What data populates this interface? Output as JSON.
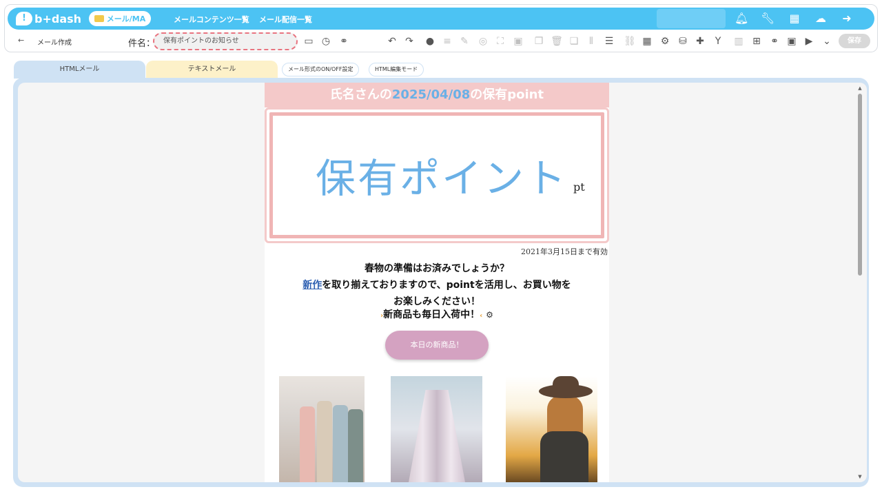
{
  "header": {
    "logo_text": "b+dash",
    "logo_bubble": "!",
    "mail_pill": "メール/MA",
    "nav": [
      "メールコンテンツ一覧",
      "メール配信一覧"
    ],
    "icons": [
      "bell-icon",
      "wrench-icon",
      "grid-icon",
      "support-icon",
      "logout-icon"
    ]
  },
  "subbar": {
    "back_arrow": "←",
    "page_title": "メール作成",
    "subject_label": "件名：",
    "subject_value": "保有ポイントのお知らせ",
    "save_label": "保存"
  },
  "tabs": {
    "html_mail": "HTMLメール",
    "text_mail": "テキストメール",
    "format_toggle": "メール形式のON/OFF設定",
    "html_edit_mode": "HTML編集モード"
  },
  "email": {
    "headline_pre": "氏名さんの",
    "headline_date": "2025/04/08",
    "headline_post": "の保有point",
    "banner_title": "保有ポイント",
    "banner_unit": "pt",
    "valid_until": "2021年3月15日まで有効",
    "line1": "春物の準備はお済みでしょうか？",
    "line2_link": "新作",
    "line2_rest": "を取り揃えておりますので、pointを活用し、お買い物を",
    "line3": "お楽しみください！",
    "new_item": "新商品も毎日入荷中！",
    "cta_label": "本日の新商品！"
  },
  "colors": {
    "header_blue": "#4cc3f3",
    "accent_pink": "#f4c9c9",
    "point_blue": "#6ab0e6",
    "cta_pink": "#d4a2c1"
  }
}
